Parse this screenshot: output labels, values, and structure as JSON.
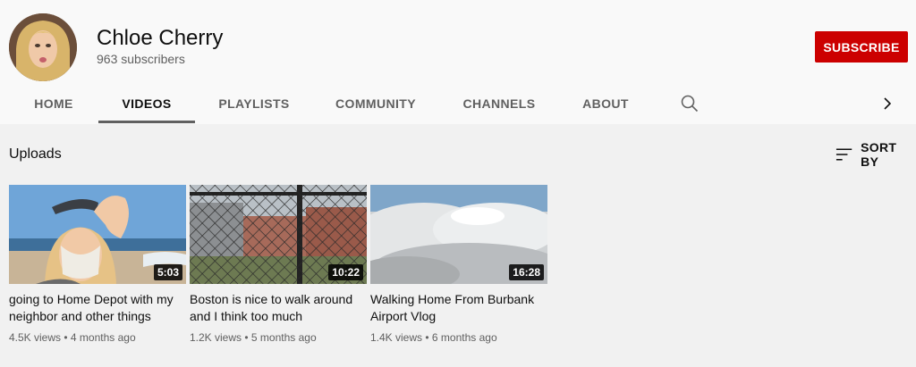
{
  "channel": {
    "name": "Chloe Cherry",
    "subscribers": "963 subscribers",
    "subscribe_label": "SUBSCRIBE"
  },
  "tabs": [
    {
      "label": "HOME",
      "active": false
    },
    {
      "label": "VIDEOS",
      "active": true
    },
    {
      "label": "PLAYLISTS",
      "active": false
    },
    {
      "label": "COMMUNITY",
      "active": false
    },
    {
      "label": "CHANNELS",
      "active": false
    },
    {
      "label": "ABOUT",
      "active": false
    }
  ],
  "icons": {
    "search": "search-icon",
    "next": "chevron-right-icon",
    "sort": "sort-icon"
  },
  "section": {
    "title": "Uploads",
    "sort_label": "SORT BY"
  },
  "videos": [
    {
      "title": "going to Home Depot with my neighbor and other things",
      "duration": "5:03",
      "views": "4.5K views",
      "age": "4 months ago"
    },
    {
      "title": "Boston is nice to walk around and I think too much",
      "duration": "10:22",
      "views": "1.2K views",
      "age": "5 months ago"
    },
    {
      "title": "Walking Home From Burbank Airport Vlog",
      "duration": "16:28",
      "views": "1.4K views",
      "age": "6 months ago"
    }
  ],
  "colors": {
    "brand_red": "#cc0000",
    "page_bg": "#f1f1f1",
    "header_bg": "#f9f9f9",
    "secondary_text": "#606060"
  }
}
